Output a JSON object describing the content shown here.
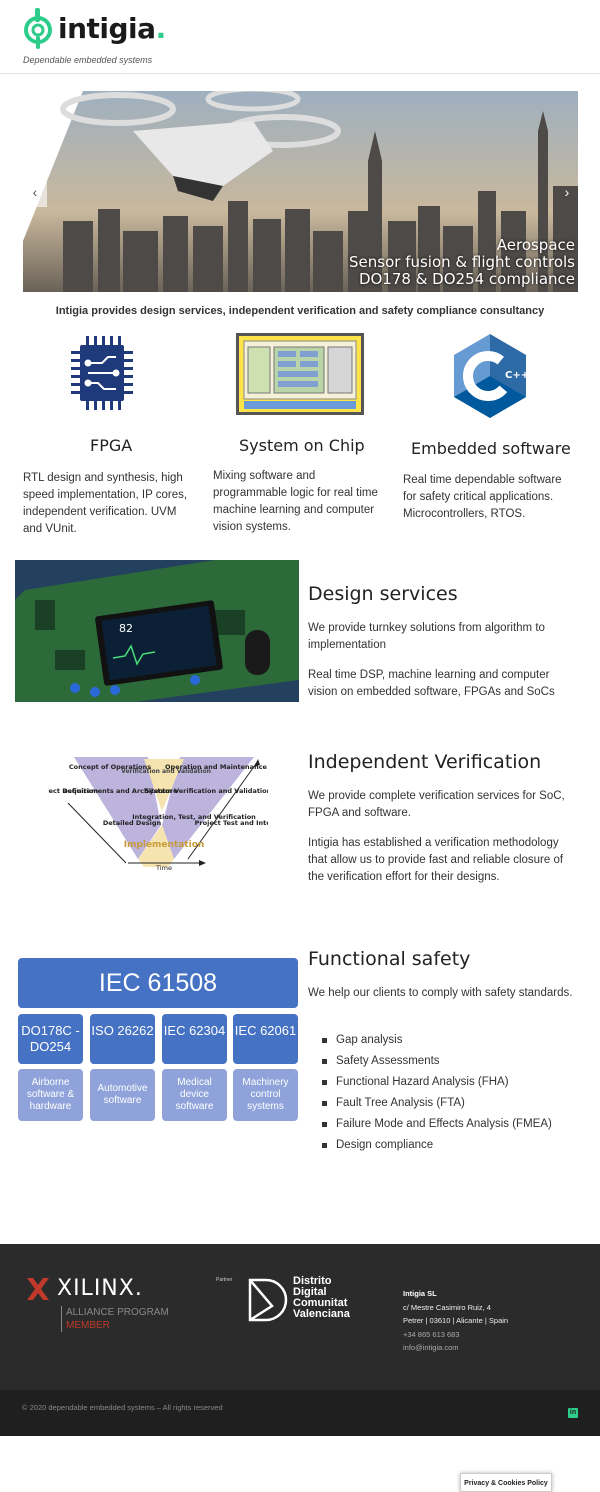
{
  "header": {
    "brand": "intigia",
    "brand_dot": ".",
    "tagline": "Dependable embedded systems"
  },
  "hero": {
    "prev_icon": "chevron-left-icon",
    "next_icon": "chevron-right-icon",
    "caption": [
      "Aerospace",
      "Sensor fusion & flight controls",
      "DO178 & DO254 compliance"
    ]
  },
  "intro": "Intigia provides design services, independent verification and safety compliance consultancy",
  "services": [
    {
      "icon": "chip-icon",
      "title": "FPGA",
      "text": "RTL design and synthesis, high speed implementation, IP cores, independent verification. UVM and VUnit."
    },
    {
      "icon": "soc-diagram-icon",
      "title": "System on Chip",
      "text": "Mixing software and programmable logic for real time machine learning and computer vision systems."
    },
    {
      "icon": "cpp-icon",
      "icon_text": "C++",
      "title": "Embedded software",
      "text": "Real time dependable software for safety critical applications. Microcontrollers, RTOS."
    }
  ],
  "design": {
    "title": "Design services",
    "p1": "We provide turnkey solutions from algorithm to implementation",
    "p2": "Real time DSP, machine learning and computer vision on embedded software, FPGAs and SoCs",
    "screen_value": "82"
  },
  "verification": {
    "title": "Independent Verification",
    "p1": "We provide complete verification services for SoC, FPGA and software.",
    "p2": "Intigia has established a verification methodology that allow us to provide fast and reliable closure of the verification effort for their designs.",
    "vmodel": {
      "concept": "Concept of Operations",
      "verif_valid": "Verification and Validation",
      "ops_maint": "Operation and Maintenance",
      "project_def": "Project Definition",
      "req_arch": "Requirements and Architecture",
      "sys_verif": "System Verification and Validation",
      "detailed": "Detailed Design",
      "integration": "Integration, Test, and Verification",
      "project_test": "Project Test and Integration",
      "implementation": "Implementation",
      "time": "Time"
    }
  },
  "safety": {
    "title": "Functional safety",
    "p1": "We help our clients to comply with safety standards.",
    "iec_main": "IEC 61508",
    "standards": [
      "DO178C - DO254",
      "ISO 26262",
      "IEC 62304",
      "IEC 62061"
    ],
    "applications": [
      "Airborne software & hardware",
      "Automotive software",
      "Medical device software",
      "Machinery control systems"
    ],
    "bullets": [
      "Gap analysis",
      "Safety Assessments",
      "Functional Hazard Analysis (FHA)",
      "Fault Tree Analysis (FTA)",
      "Failure Mode and Effects Analysis (FMEA)",
      "Design compliance"
    ]
  },
  "footer": {
    "xilinx_word": "XILINX.",
    "xilinx_program": "ALLIANCE PROGRAM",
    "xilinx_member": "MEMBER",
    "partner_label": "Partner",
    "ddcv": [
      "Distrito",
      "Digital",
      "Comunitat",
      "Valenciana"
    ],
    "contact": {
      "company": "Intigia SL",
      "address1": "c/ Mestre Casimiro Ruiz, 4",
      "address2": "Petrer | 03610 | Alicante | Spain",
      "phone": "+34 865 613 683",
      "email": "info@intigia.com"
    },
    "copyright": "© 2020 dependable embedded systems – All rights reserved",
    "linkedin": "in"
  },
  "cookie": "Privacy & Cookies Policy",
  "colors": {
    "brand_green": "#2ecc8a",
    "iec_blue": "#4672c4",
    "app_blue": "#8fa3da",
    "footer_dark": "#2b2b2b"
  }
}
